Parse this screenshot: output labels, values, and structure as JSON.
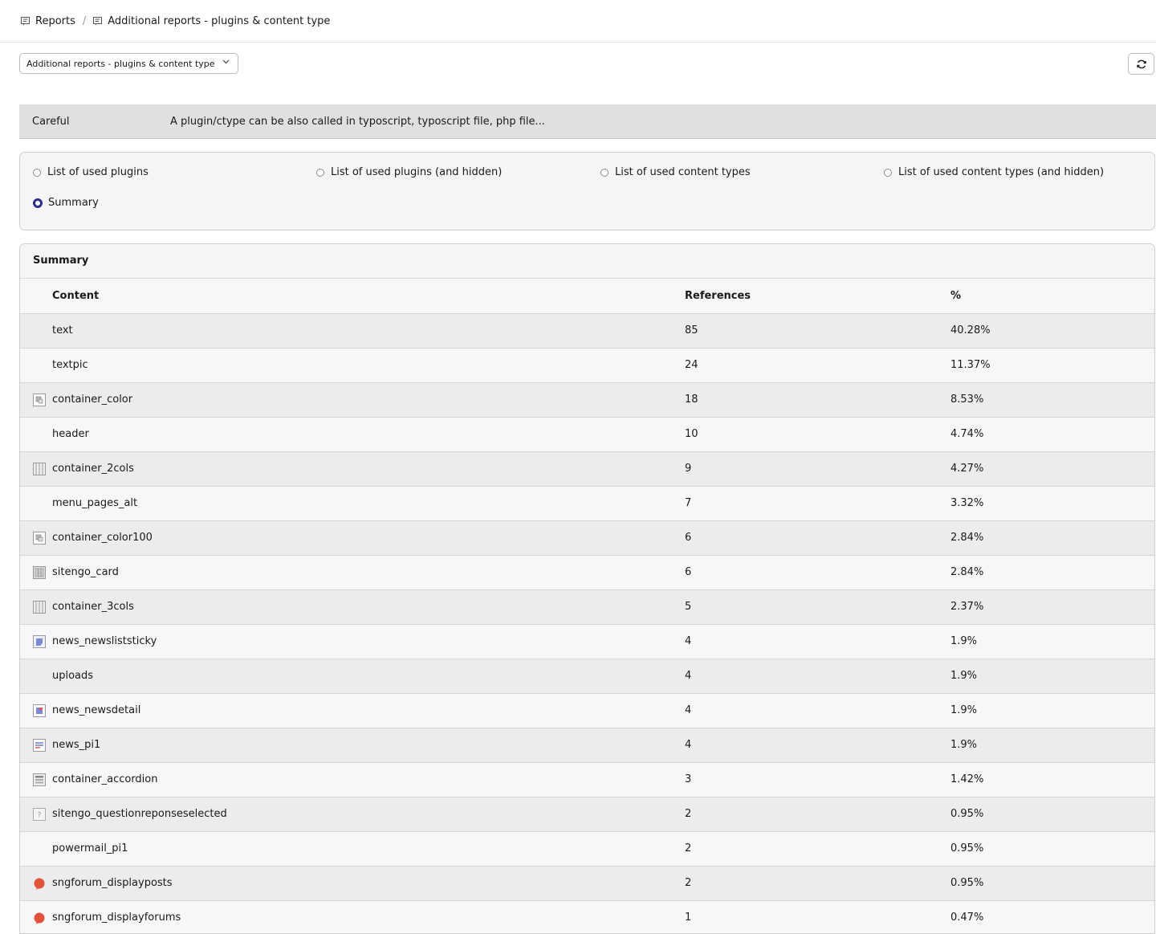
{
  "breadcrumb": {
    "items": [
      "Reports",
      "Additional reports - plugins & content type"
    ],
    "separator": "/"
  },
  "header": {
    "select_value": "Additional reports - plugins & content type"
  },
  "notice": {
    "label": "Careful",
    "message": "A plugin/ctype can be also called in typoscript, typoscript file, php file..."
  },
  "options": [
    {
      "label": "List of used plugins",
      "checked": false
    },
    {
      "label": "List of used plugins (and hidden)",
      "checked": false
    },
    {
      "label": "List of used content types",
      "checked": false
    },
    {
      "label": "List of used content types (and hidden)",
      "checked": false
    },
    {
      "label": "Summary",
      "checked": true
    }
  ],
  "summary": {
    "title": "Summary",
    "columns": [
      "Content",
      "References",
      "%"
    ],
    "rows": [
      {
        "icon": "none",
        "content": "text",
        "refs": "85",
        "pct": "40.28%"
      },
      {
        "icon": "none",
        "content": "textpic",
        "refs": "24",
        "pct": "11.37%"
      },
      {
        "icon": "container-icon",
        "content": "container_color",
        "refs": "18",
        "pct": "8.53%"
      },
      {
        "icon": "none",
        "content": "header",
        "refs": "10",
        "pct": "4.74%"
      },
      {
        "icon": "columns-icon",
        "content": "container_2cols",
        "refs": "9",
        "pct": "4.27%"
      },
      {
        "icon": "none",
        "content": "menu_pages_alt",
        "refs": "7",
        "pct": "3.32%"
      },
      {
        "icon": "container-icon",
        "content": "container_color100",
        "refs": "6",
        "pct": "2.84%"
      },
      {
        "icon": "grid-icon",
        "content": "sitengo_card",
        "refs": "6",
        "pct": "2.84%"
      },
      {
        "icon": "columns-icon",
        "content": "container_3cols",
        "refs": "5",
        "pct": "2.37%"
      },
      {
        "icon": "news-sticky-icon",
        "content": "news_newsliststicky",
        "refs": "4",
        "pct": "1.9%"
      },
      {
        "icon": "none",
        "content": "uploads",
        "refs": "4",
        "pct": "1.9%"
      },
      {
        "icon": "news-detail-icon",
        "content": "news_newsdetail",
        "refs": "4",
        "pct": "1.9%"
      },
      {
        "icon": "news-list-icon",
        "content": "news_pi1",
        "refs": "4",
        "pct": "1.9%"
      },
      {
        "icon": "accordion-icon",
        "content": "container_accordion",
        "refs": "3",
        "pct": "1.42%"
      },
      {
        "icon": "question-icon",
        "content": "sitengo_questionreponseselected",
        "refs": "2",
        "pct": "0.95%"
      },
      {
        "icon": "none",
        "content": "powermail_pi1",
        "refs": "2",
        "pct": "0.95%"
      },
      {
        "icon": "forum-icon",
        "content": "sngforum_displayposts",
        "refs": "2",
        "pct": "0.95%"
      },
      {
        "icon": "forum-icon",
        "content": "sngforum_displayforums",
        "refs": "1",
        "pct": "0.47%"
      }
    ]
  },
  "colors": {
    "radio_checked": "#2b2b8a",
    "forum_icon": "#e0533a",
    "notice_bg": "#e0e0e0"
  }
}
